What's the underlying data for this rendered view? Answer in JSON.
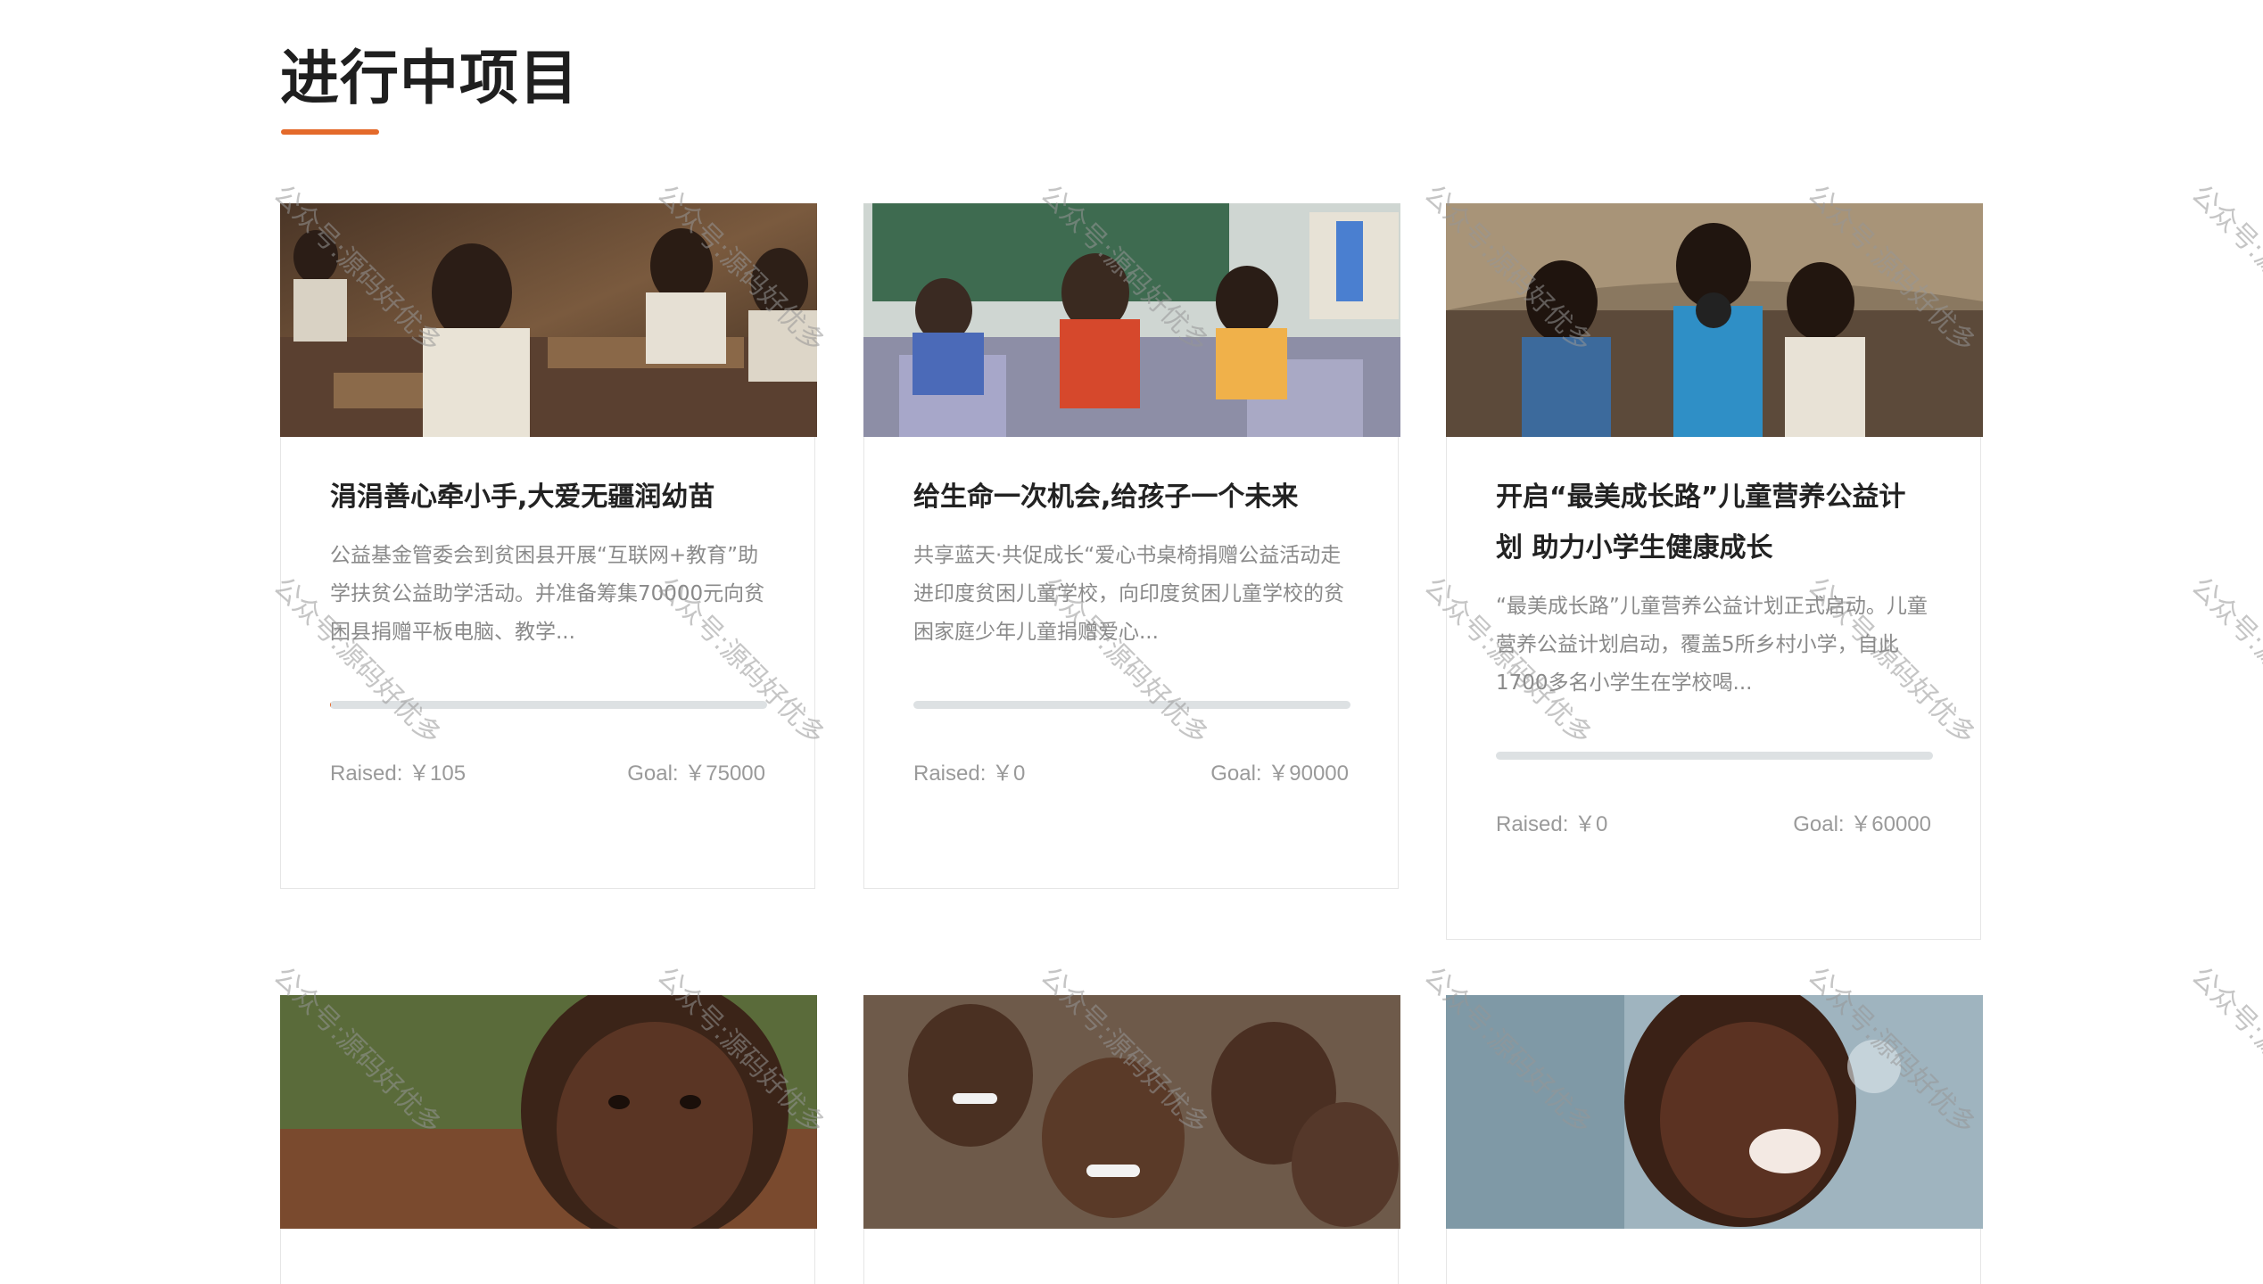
{
  "section": {
    "title": "进行中项目"
  },
  "projects": [
    {
      "title": "涓涓善心牵小手,大爱无疆润幼苗",
      "description": "公益基金管委会到贫困县开展“互联网+教育”助学扶贫公益助学活动。并准备筹集70000元向贫困县捐赠平板电脑、教学...",
      "raised": "Raised: ￥105",
      "goal": "Goal: ￥75000",
      "progress": 0.0014,
      "image_alt": "classroom-children-photo"
    },
    {
      "title": "给生命一次机会,给孩子一个未来",
      "description": "共享蓝天·共促成长“爱心书桌椅捐赠公益活动走进印度贫困儿童学校，向印度贫困儿童学校的贫困家庭少年儿童捐赠爱心...",
      "raised": "Raised: ￥0",
      "goal": "Goal: ￥90000",
      "progress": 0,
      "image_alt": "kids-in-classroom-photo"
    },
    {
      "title": "开启“最美成长路”儿童营养公益计划 助力小学生健康成长",
      "description": "“最美成长路”儿童营养公益计划正式启动。儿童营养公益计划启动，覆盖5所乡村小学，自此1700多名小学生在学校喝...",
      "raised": "Raised: ￥0",
      "goal": "Goal: ￥60000",
      "progress": 0,
      "image_alt": "boys-with-camera-photo"
    },
    {
      "image_alt": "child-looking-up-photo"
    },
    {
      "image_alt": "smiling-children-group-photo"
    },
    {
      "image_alt": "laughing-boy-water-photo"
    }
  ],
  "watermark": {
    "text": "公众号:源码好优多"
  },
  "colors": {
    "accent": "#e46a2b",
    "progress_track": "#dde1e3"
  }
}
